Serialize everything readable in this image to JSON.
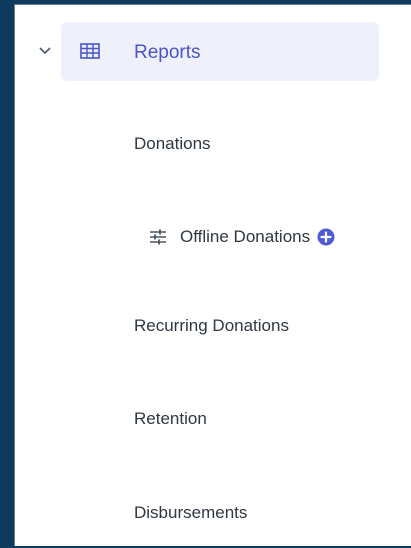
{
  "nav": {
    "collapse_icon": "chevron-down-icon",
    "reports": {
      "icon": "table-grid-icon",
      "label": "Reports",
      "active": true
    },
    "items": [
      {
        "label": "Donations"
      },
      {
        "label": "Offline Donations",
        "icon": "sliders-icon",
        "action_icon": "add-circle-icon"
      },
      {
        "label": "Recurring Donations"
      },
      {
        "label": "Retention"
      },
      {
        "label": "Disbursements"
      }
    ]
  },
  "colors": {
    "accent": "#4a55c7",
    "active_bg": "#eef0fc",
    "add_button": "#4f5bd5",
    "text": "#2f3740",
    "frame_bg": "#0e3a5e"
  }
}
